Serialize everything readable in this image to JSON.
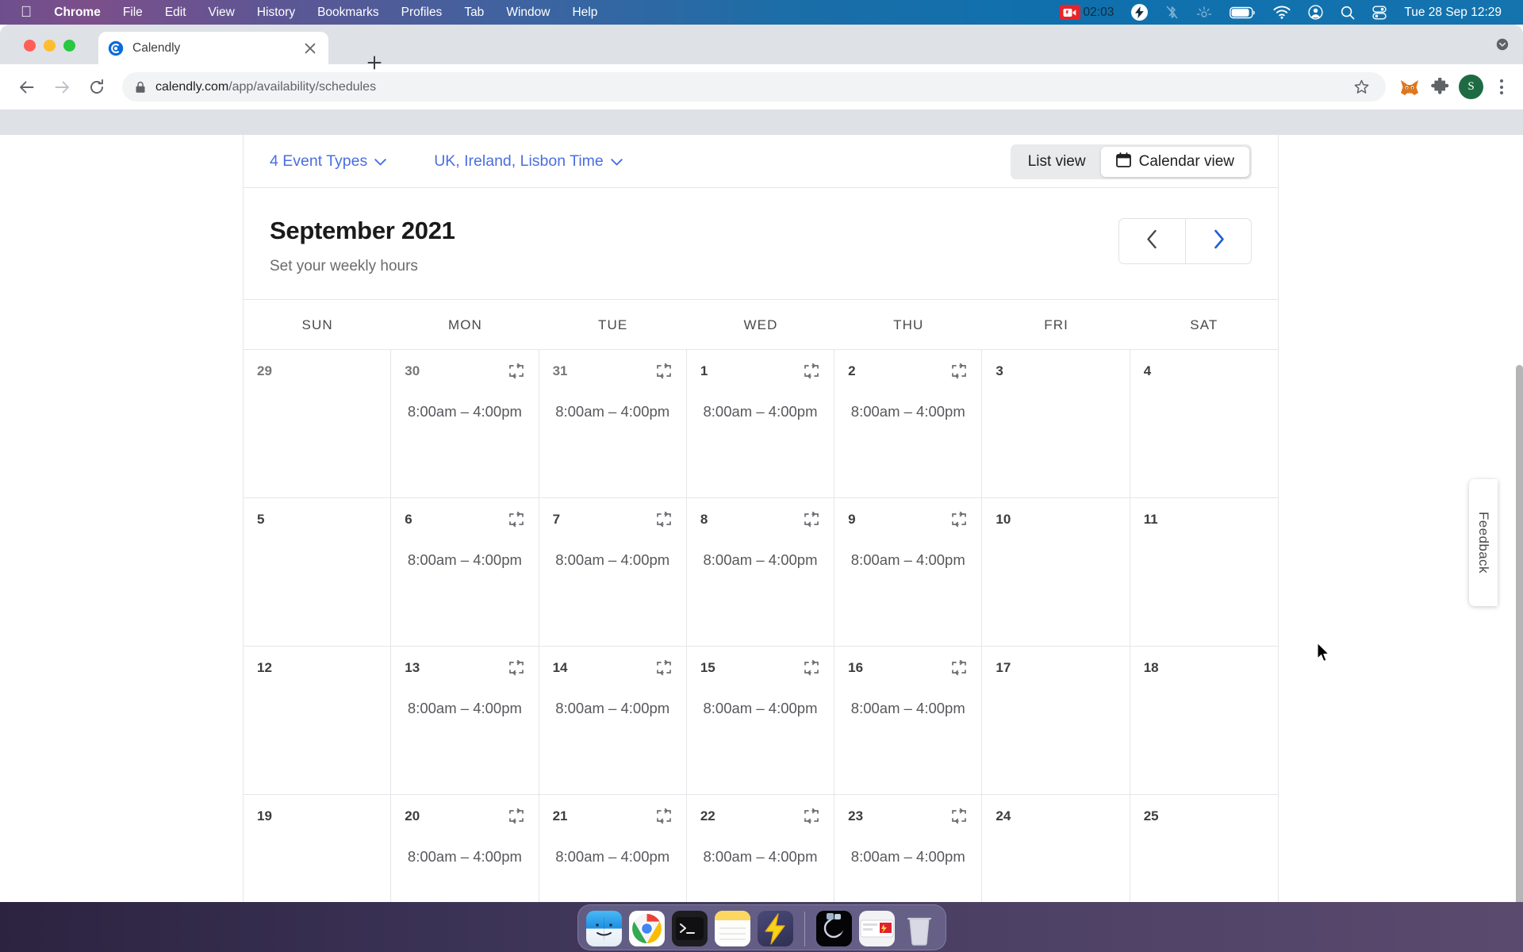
{
  "menubar": {
    "apple_icon": "apple-logo-icon",
    "items": [
      {
        "label": "Chrome",
        "bold": true
      },
      {
        "label": "File",
        "bold": false
      },
      {
        "label": "Edit",
        "bold": false
      },
      {
        "label": "View",
        "bold": false
      },
      {
        "label": "History",
        "bold": false
      },
      {
        "label": "Bookmarks",
        "bold": false
      },
      {
        "label": "Profiles",
        "bold": false
      },
      {
        "label": "Tab",
        "bold": false
      },
      {
        "label": "Window",
        "bold": false
      },
      {
        "label": "Help",
        "bold": false
      }
    ],
    "recording_time": "02:03",
    "status_icons": [
      "screen-recording-icon",
      "flash-icon",
      "bluetooth-off-icon",
      "brightness-icon",
      "battery-icon",
      "wifi-icon",
      "user-account-icon",
      "search-icon",
      "control-center-icon"
    ],
    "datetime": "Tue 28 Sep  12:29"
  },
  "browser": {
    "tab": {
      "title": "Calendly",
      "favicon": "calendly-logo-icon"
    },
    "new_tab_label": "+",
    "url_host": "calendly.com",
    "url_path": "/app/availability/schedules",
    "extensions": [
      "metamask-icon",
      "puzzle-extensions-icon"
    ],
    "profile_initial": "S"
  },
  "page": {
    "filters": [
      {
        "label": "4 Event Types"
      },
      {
        "label": "UK, Ireland, Lisbon Time"
      }
    ],
    "view_toggle": {
      "list_label": "List view",
      "calendar_label": "Calendar view",
      "active": "Calendar view"
    },
    "month_title": "September 2021",
    "month_subtitle": "Set your weekly hours",
    "nav": {
      "prev": "chevron-left-icon",
      "next": "chevron-right-icon"
    },
    "weekdays": [
      "SUN",
      "MON",
      "TUE",
      "WED",
      "THU",
      "FRI",
      "SAT"
    ],
    "days": [
      {
        "num": "29",
        "hours": "",
        "copy": false,
        "muted": true
      },
      {
        "num": "30",
        "hours": "8:00am – 4:00pm",
        "copy": true,
        "muted": true
      },
      {
        "num": "31",
        "hours": "8:00am – 4:00pm",
        "copy": true,
        "muted": true
      },
      {
        "num": "1",
        "hours": "8:00am – 4:00pm",
        "copy": true,
        "muted": false
      },
      {
        "num": "2",
        "hours": "8:00am – 4:00pm",
        "copy": true,
        "muted": false
      },
      {
        "num": "3",
        "hours": "",
        "copy": false,
        "muted": false
      },
      {
        "num": "4",
        "hours": "",
        "copy": false,
        "muted": false
      },
      {
        "num": "5",
        "hours": "",
        "copy": false,
        "muted": false
      },
      {
        "num": "6",
        "hours": "8:00am – 4:00pm",
        "copy": true,
        "muted": false
      },
      {
        "num": "7",
        "hours": "8:00am – 4:00pm",
        "copy": true,
        "muted": false
      },
      {
        "num": "8",
        "hours": "8:00am – 4:00pm",
        "copy": true,
        "muted": false
      },
      {
        "num": "9",
        "hours": "8:00am – 4:00pm",
        "copy": true,
        "muted": false
      },
      {
        "num": "10",
        "hours": "",
        "copy": false,
        "muted": false
      },
      {
        "num": "11",
        "hours": "",
        "copy": false,
        "muted": false
      },
      {
        "num": "12",
        "hours": "",
        "copy": false,
        "muted": false
      },
      {
        "num": "13",
        "hours": "8:00am – 4:00pm",
        "copy": true,
        "muted": false
      },
      {
        "num": "14",
        "hours": "8:00am – 4:00pm",
        "copy": true,
        "muted": false
      },
      {
        "num": "15",
        "hours": "8:00am – 4:00pm",
        "copy": true,
        "muted": false
      },
      {
        "num": "16",
        "hours": "8:00am – 4:00pm",
        "copy": true,
        "muted": false
      },
      {
        "num": "17",
        "hours": "",
        "copy": false,
        "muted": false
      },
      {
        "num": "18",
        "hours": "",
        "copy": false,
        "muted": false
      },
      {
        "num": "19",
        "hours": "",
        "copy": false,
        "muted": false
      },
      {
        "num": "20",
        "hours": "8:00am – 4:00pm",
        "copy": true,
        "muted": false
      },
      {
        "num": "21",
        "hours": "8:00am – 4:00pm",
        "copy": true,
        "muted": false
      },
      {
        "num": "22",
        "hours": "8:00am – 4:00pm",
        "copy": true,
        "muted": false
      },
      {
        "num": "23",
        "hours": "8:00am – 4:00pm",
        "copy": true,
        "muted": false
      },
      {
        "num": "24",
        "hours": "",
        "copy": false,
        "muted": false
      },
      {
        "num": "25",
        "hours": "",
        "copy": false,
        "muted": false
      }
    ],
    "feedback_label": "Feedback"
  },
  "dock": {
    "items": [
      "finder-icon",
      "chrome-icon",
      "terminal-icon",
      "notes-icon",
      "lightning-icon",
      "eclipse-app-icon",
      "mail-app-icon",
      "trash-icon"
    ]
  },
  "colors": {
    "accent_blue": "#4a6ee0",
    "nav_blue": "#1f5fd6",
    "menubar_start": "#6e4f8e",
    "menubar_end": "#1573ae",
    "recording_red": "#e8232a"
  }
}
